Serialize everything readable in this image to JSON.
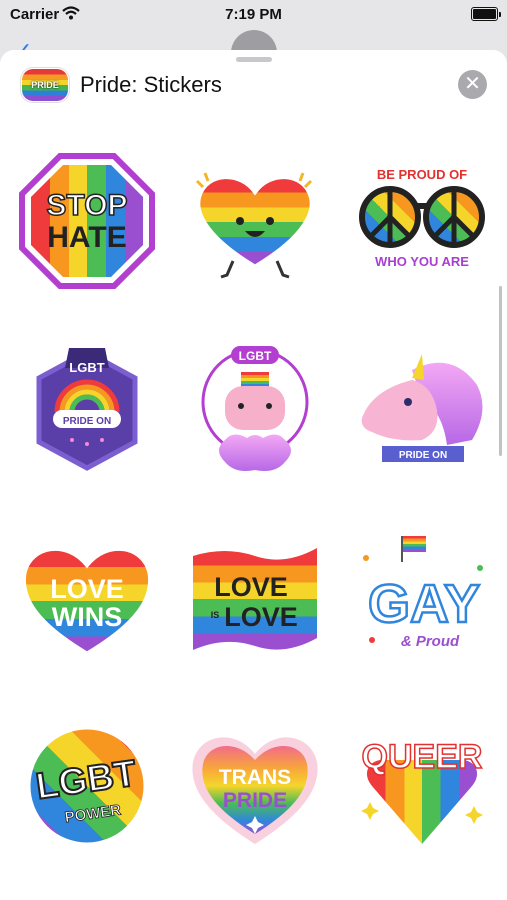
{
  "status_bar": {
    "carrier": "Carrier",
    "time": "7:19 PM"
  },
  "sheet": {
    "title": "Pride: Stickers",
    "app_icon_text": "PRIDE"
  },
  "stickers": [
    {
      "name": "stop-hate",
      "line1": "STOP",
      "line2": "HATE"
    },
    {
      "name": "happy-rainbow-heart"
    },
    {
      "name": "be-proud-of-who-you-are",
      "top": "BE PROUD OF",
      "bottom": "WHO YOU ARE"
    },
    {
      "name": "lgbt-pride-on-badge",
      "top": "LGBT",
      "ribbon": "PRIDE ON"
    },
    {
      "name": "lgbt-cat",
      "top": "LGBT"
    },
    {
      "name": "pride-on-unicorn",
      "ribbon": "PRIDE ON"
    },
    {
      "name": "love-wins-heart",
      "line1": "LOVE",
      "line2": "WINS"
    },
    {
      "name": "love-is-love-flag",
      "line1": "LOVE",
      "small": "IS",
      "line2": "LOVE"
    },
    {
      "name": "gay-and-proud",
      "line1": "GAY",
      "line2": "& Proud"
    },
    {
      "name": "lgbt-power",
      "line1": "LGBT",
      "line2": "POWER"
    },
    {
      "name": "trans-pride-heart",
      "line1": "TRANS",
      "line2": "PRIDE"
    },
    {
      "name": "queer-heart",
      "line1": "QUEER"
    }
  ]
}
